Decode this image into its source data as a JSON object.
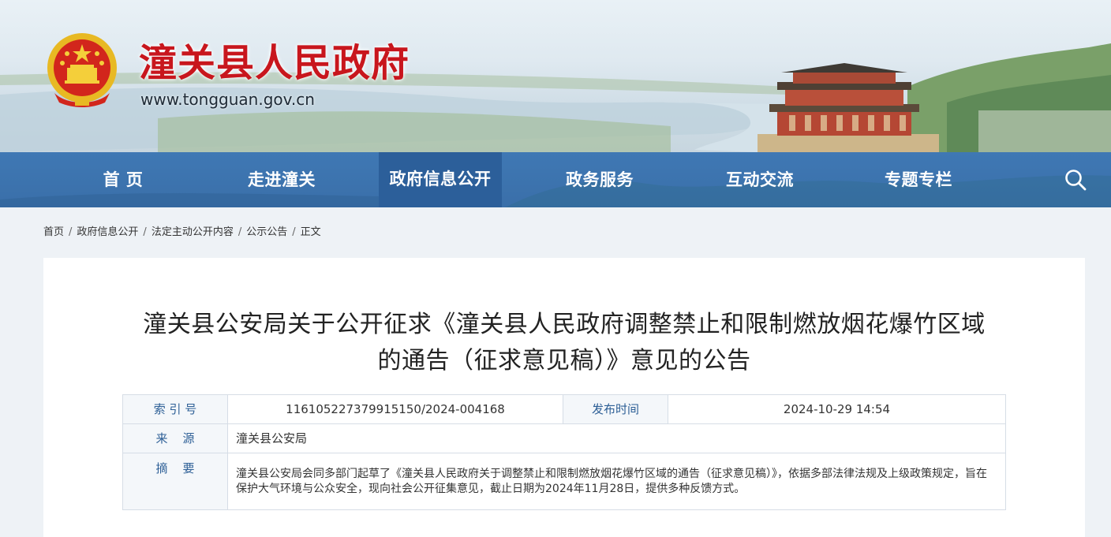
{
  "site": {
    "title": "潼关县人民政府",
    "url": "www.tongguan.gov.cn"
  },
  "nav": {
    "items": [
      {
        "label": "首 页"
      },
      {
        "label": "走进潼关"
      },
      {
        "label": "政府信息公开"
      },
      {
        "label": "政务服务"
      },
      {
        "label": "互动交流"
      },
      {
        "label": "专题专栏"
      }
    ],
    "active_index": 2,
    "search_icon": "search-icon"
  },
  "breadcrumb": {
    "items": [
      "首页",
      "政府信息公开",
      "法定主动公开内容",
      "公示公告"
    ],
    "current": "正文",
    "separator": "/"
  },
  "article": {
    "title_line1": "潼关县公安局关于公开征求《潼关县人民政府调整禁止和限制燃放烟花爆竹区域",
    "title_line2": "的通告（征求意见稿）》意见的公告"
  },
  "meta": {
    "index_label": "索 引 号",
    "index_value": "116105227379915150/2024-004168",
    "publish_label": "发布时间",
    "publish_value": "2024-10-29 14:54",
    "source_label": "来    源",
    "source_value": "潼关县公安局",
    "summary_label": "摘    要",
    "summary_value": "潼关县公安局会同多部门起草了《潼关县人民政府关于调整禁止和限制燃放烟花爆竹区域的通告（征求意见稿）》，依据多部法律法规及上级政策规定，旨在保护大气环境与公众安全，现向社会公开征集意见，截止日期为2024年11月28日，提供多种反馈方式。"
  },
  "colors": {
    "title_red": "#c8161d",
    "nav_blue": "#3a6fa9",
    "nav_active": "#2c5f9a",
    "label_blue": "#2d5f96"
  }
}
